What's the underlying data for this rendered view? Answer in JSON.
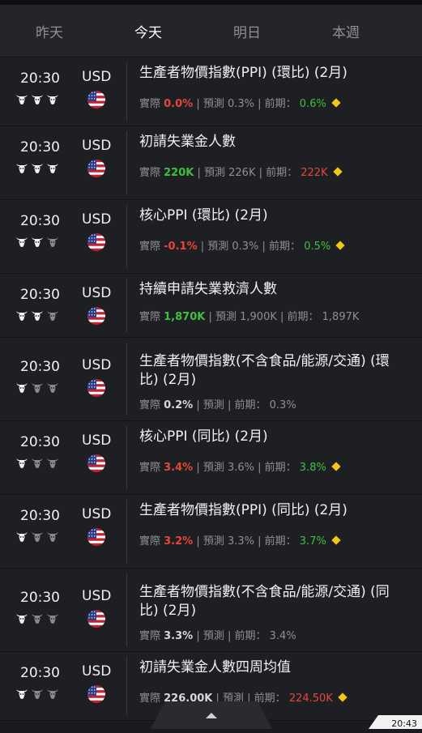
{
  "tabs": [
    "昨天",
    "今天",
    "明日",
    "本週"
  ],
  "active_tab_index": 1,
  "labels": {
    "actual": "實際",
    "forecast": "預測",
    "previous": "前期："
  },
  "colors": {
    "up": "#3fbf3f",
    "down": "#e8453c",
    "neutral": "#d8d8d8",
    "diamond": "#f5c518"
  },
  "events": [
    {
      "time": "20:30",
      "currency": "USD",
      "importance": 3,
      "title": "生產者物價指數(PPI) (環比) (2月)",
      "actual": "0.0%",
      "actual_color": "red",
      "forecast": "0.3%",
      "previous": "0.6%",
      "previous_color": "green",
      "diamond": true
    },
    {
      "time": "20:30",
      "currency": "USD",
      "importance": 3,
      "title": "初請失業金人數",
      "actual": "220K",
      "actual_color": "green",
      "forecast": "226K",
      "previous": "222K",
      "previous_color": "red",
      "diamond": true
    },
    {
      "time": "20:30",
      "currency": "USD",
      "importance": 2,
      "title": "核心PPI (環比) (2月)",
      "actual": "-0.1%",
      "actual_color": "red",
      "forecast": "0.3%",
      "previous": "0.5%",
      "previous_color": "green",
      "diamond": true
    },
    {
      "time": "20:30",
      "currency": "USD",
      "importance": 2,
      "title": "持續申請失業救濟人數",
      "actual": "1,870K",
      "actual_color": "green",
      "forecast": "1,900K",
      "previous": "1,897K",
      "previous_color": "none",
      "diamond": false
    },
    {
      "time": "20:30",
      "currency": "USD",
      "importance": 1,
      "title": "生產者物價指數(不含食品/能源/交通) (環比) (2月)",
      "actual": "0.2%",
      "actual_color": "white",
      "forecast": "",
      "previous": "0.3%",
      "previous_color": "none",
      "diamond": false
    },
    {
      "time": "20:30",
      "currency": "USD",
      "importance": 1,
      "title": "核心PPI (同比) (2月)",
      "actual": "3.4%",
      "actual_color": "red",
      "forecast": "3.6%",
      "previous": "3.8%",
      "previous_color": "green",
      "diamond": true
    },
    {
      "time": "20:30",
      "currency": "USD",
      "importance": 1,
      "title": "生產者物價指數(PPI) (同比) (2月)",
      "actual": "3.2%",
      "actual_color": "red",
      "forecast": "3.3%",
      "previous": "3.7%",
      "previous_color": "green",
      "diamond": true
    },
    {
      "time": "20:30",
      "currency": "USD",
      "importance": 1,
      "title": "生產者物價指數(不含食品/能源/交通) (同比) (2月)",
      "actual": "3.3%",
      "actual_color": "white",
      "forecast": "",
      "previous": "3.4%",
      "previous_color": "none",
      "diamond": false
    },
    {
      "time": "20:30",
      "currency": "USD",
      "importance": 1,
      "title": "初請失業金人數四周均值",
      "actual": "226.00K",
      "actual_color": "white",
      "forecast": "",
      "previous": "224.50K",
      "previous_color": "red",
      "diamond": true
    }
  ],
  "status_clock": "20:43"
}
